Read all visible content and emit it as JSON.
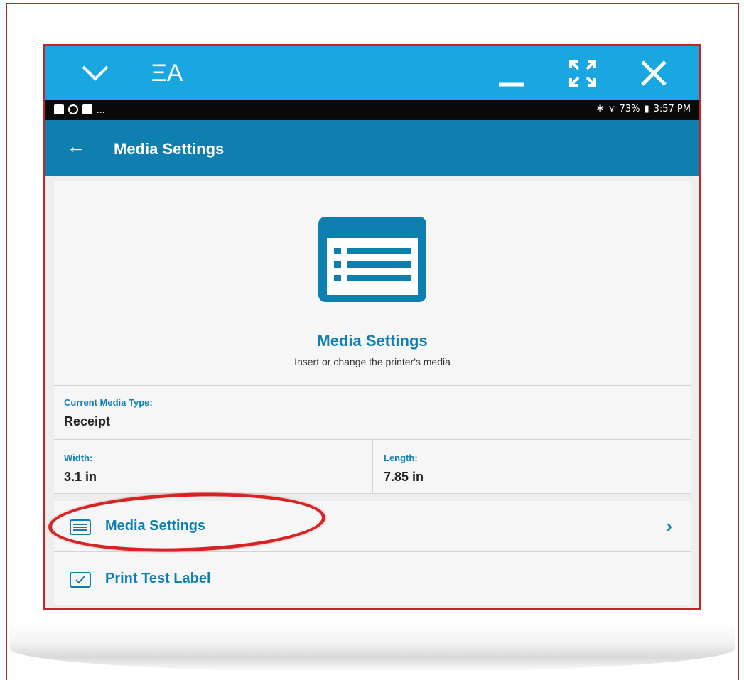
{
  "window": {
    "titlebar_color": "#1aa7e1",
    "app_logo": "ΞA",
    "icons": {
      "collapse": "chevron-down-icon",
      "minimize": "minimize-icon",
      "fullscreen": "fullscreen-icon",
      "close": "close-icon"
    }
  },
  "statusbar": {
    "left_overflow": "...",
    "battery": "73%",
    "time": "3:57 PM"
  },
  "appbar": {
    "title": "Media Settings",
    "color": "#0f7fb0"
  },
  "hero": {
    "title": "Media Settings",
    "subtitle": "Insert or change the printer's media"
  },
  "media_info": {
    "type_label": "Current Media Type:",
    "type_value": "Receipt",
    "width_label": "Width:",
    "width_value": "3.1 in",
    "length_label": "Length:",
    "length_value": "7.85 in"
  },
  "menu": {
    "items": [
      {
        "label": "Media Settings",
        "icon": "list-icon",
        "chevron": "›"
      },
      {
        "label": "Print Test Label",
        "icon": "checkbox-icon"
      }
    ]
  },
  "annotation": {
    "highlight_color": "#d42424"
  }
}
